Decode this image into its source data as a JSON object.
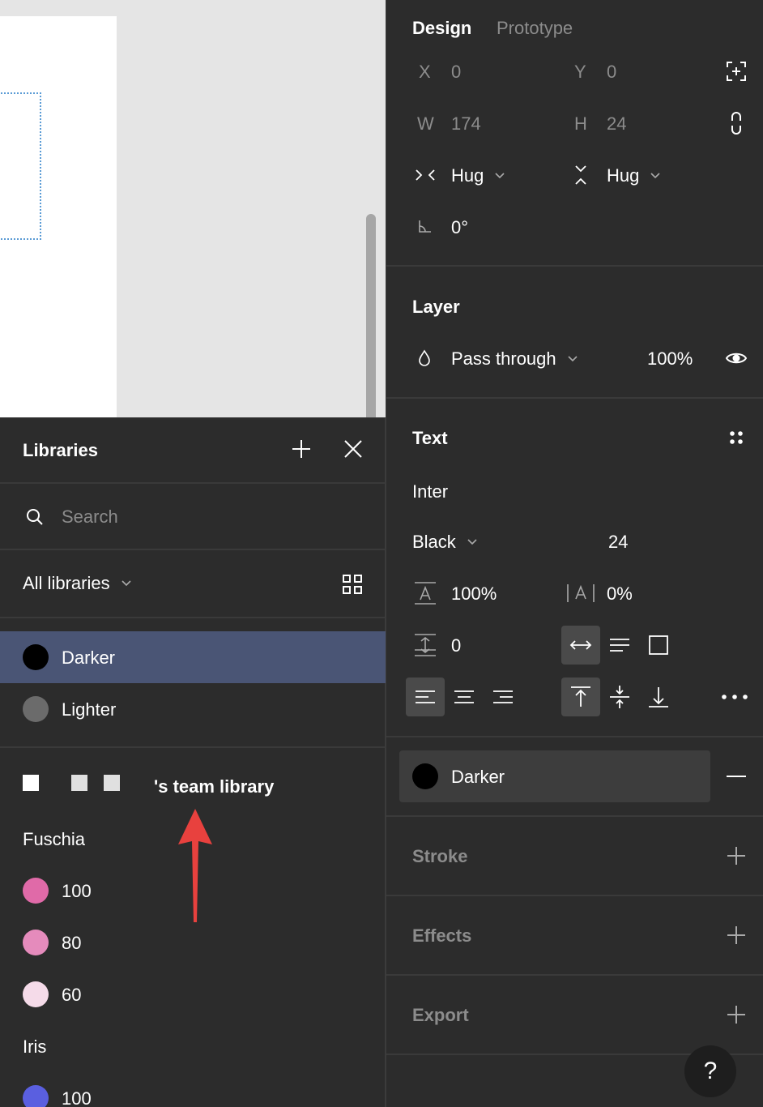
{
  "canvas": {},
  "libraries": {
    "title": "Libraries",
    "search_placeholder": "Search",
    "filter_label": "All libraries",
    "local_styles": [
      {
        "label": "Darker",
        "color": "#000000",
        "selected": true
      },
      {
        "label": "Lighter",
        "color": "#6b6b6b",
        "selected": false
      }
    ],
    "team_library_label": "'s team library",
    "groups": [
      {
        "name": "Fuschia",
        "items": [
          {
            "label": "100",
            "color": "#e06aa8"
          },
          {
            "label": "80",
            "color": "#e58bbc"
          },
          {
            "label": "60",
            "color": "#f5dbe9"
          }
        ]
      },
      {
        "name": "Iris",
        "items": [
          {
            "label": "100",
            "color": "#5a5fe0"
          }
        ]
      }
    ]
  },
  "design_panel": {
    "tabs": {
      "design": "Design",
      "prototype": "Prototype"
    },
    "x_label": "X",
    "x_value": "0",
    "y_label": "Y",
    "y_value": "0",
    "w_label": "W",
    "w_value": "174",
    "h_label": "H",
    "h_value": "24",
    "width_mode": "Hug",
    "height_mode": "Hug",
    "rotation": "0°",
    "layer": {
      "title": "Layer",
      "blend_mode": "Pass through",
      "opacity": "100%"
    },
    "text": {
      "title": "Text",
      "font_family": "Inter",
      "font_weight": "Black",
      "font_size": "24",
      "line_height": "100%",
      "letter_spacing": "0%",
      "paragraph_spacing": "0"
    },
    "fill": {
      "style_name": "Darker",
      "color": "#000000"
    },
    "stroke_title": "Stroke",
    "effects_title": "Effects",
    "export_title": "Export",
    "help_label": "?"
  },
  "annotation": {
    "arrow_color": "#e8413e"
  }
}
